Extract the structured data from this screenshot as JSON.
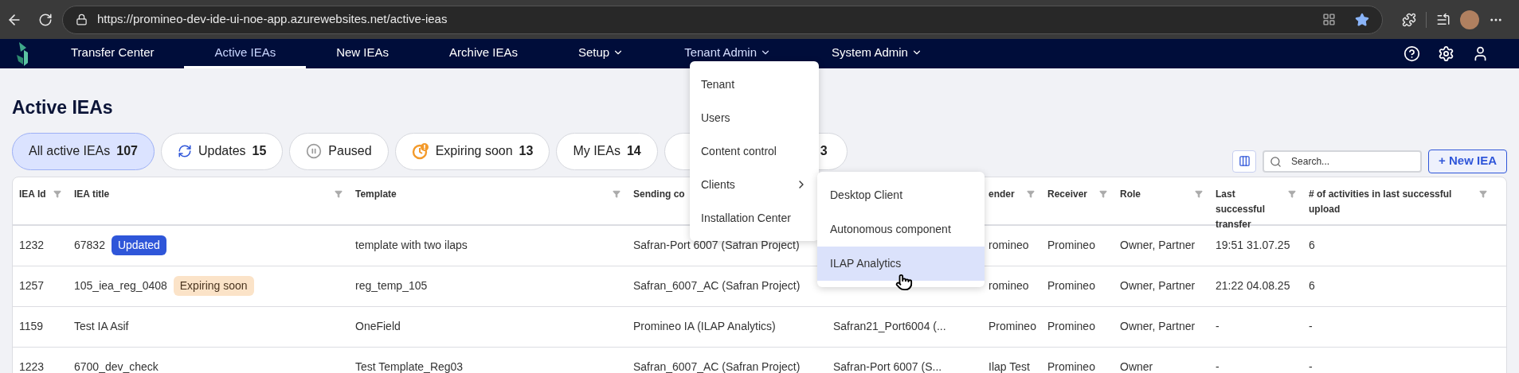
{
  "browser": {
    "url": "https://promineo-dev-ide-ui-noe-app.azurewebsites.net/active-ieas"
  },
  "nav": {
    "items": [
      {
        "label": "Transfer Center",
        "selected": false,
        "dropdown": false,
        "expanded": false
      },
      {
        "label": "Active IEAs",
        "selected": true,
        "dropdown": false,
        "expanded": false
      },
      {
        "label": "New IEAs",
        "selected": false,
        "dropdown": false,
        "expanded": false
      },
      {
        "label": "Archive IEAs",
        "selected": false,
        "dropdown": false,
        "expanded": false
      },
      {
        "label": "Setup",
        "selected": false,
        "dropdown": true,
        "expanded": false
      },
      {
        "label": "Tenant Admin",
        "selected": false,
        "dropdown": true,
        "expanded": true
      },
      {
        "label": "System Admin",
        "selected": false,
        "dropdown": true,
        "expanded": false
      }
    ]
  },
  "menu": {
    "items": [
      {
        "label": "Tenant",
        "submenu": false
      },
      {
        "label": "Users",
        "submenu": false
      },
      {
        "label": "Content control",
        "submenu": false
      },
      {
        "label": "Clients",
        "submenu": true
      },
      {
        "label": "Installation Center",
        "submenu": false
      }
    ],
    "submenu": {
      "items": [
        {
          "label": "Desktop Client",
          "selected": false
        },
        {
          "label": "Autonomous component",
          "selected": false
        },
        {
          "label": "ILAP Analytics",
          "selected": true
        }
      ]
    }
  },
  "page_title": "Active IEAs",
  "filters": [
    {
      "kind": "all",
      "label": "All active IEAs",
      "count": "107",
      "selected": true
    },
    {
      "kind": "updates",
      "label": "Updates",
      "count": "15",
      "selected": false
    },
    {
      "kind": "paused",
      "label": "Paused",
      "selected": false
    },
    {
      "kind": "expiring",
      "label": "Expiring soon",
      "count": "13",
      "selected": false
    },
    {
      "kind": "mine",
      "label": "My IEAs",
      "count": "14",
      "selected": false
    },
    {
      "kind": "other",
      "count": "3",
      "selected": false
    }
  ],
  "search": {
    "placeholder": "Search..."
  },
  "new_button": "+ New IEA",
  "table": {
    "columns": [
      {
        "label": "IEA Id",
        "filter": true
      },
      {
        "label": "IEA title",
        "filter": true
      },
      {
        "label": "Template",
        "filter": true
      },
      {
        "label": "Sending co",
        "filter": false
      },
      {},
      {
        "label": "ender",
        "filter": true
      },
      {
        "label": "Receiver",
        "filter": true
      },
      {
        "label": "Role",
        "filter": true
      },
      {
        "label": "Last successful transfer",
        "filter": true
      },
      {
        "label": "# of activities in last successful upload",
        "filter": true
      }
    ],
    "rows": [
      {
        "cells": [
          "1232",
          "67832",
          "template with two ilaps",
          "Safran-Port 6007 (Safran Project)",
          null,
          "romineo",
          "Promineo",
          "Owner, Partner",
          "19:51 31.07.25",
          "6"
        ],
        "badge": {
          "kind": "updated",
          "text": "Updated"
        }
      },
      {
        "cells": [
          "1257",
          "105_iea_reg_0408",
          "reg_temp_105",
          "Safran_6007_AC (Safran Project)",
          null,
          "romineo",
          "Promineo",
          "Owner, Partner",
          "21:22 04.08.25",
          "6"
        ],
        "badge": {
          "kind": "expiring",
          "text": "Expiring soon"
        }
      },
      {
        "cells": [
          "1159",
          "Test IA Asif",
          "OneField",
          "Promineo IA (ILAP Analytics)",
          "Safran21_Port6004 (...",
          "Promineo",
          "Promineo",
          "Owner, Partner",
          "-",
          "-"
        ]
      },
      {
        "cells": [
          "1223",
          "6700_dev_check",
          "Test Template_Reg03",
          "Safran_6007_AC (Safran Project)",
          "Safran-Port 6007 (S...",
          "Ilap Test",
          "Promineo",
          "Owner",
          "-",
          "-"
        ]
      }
    ]
  }
}
